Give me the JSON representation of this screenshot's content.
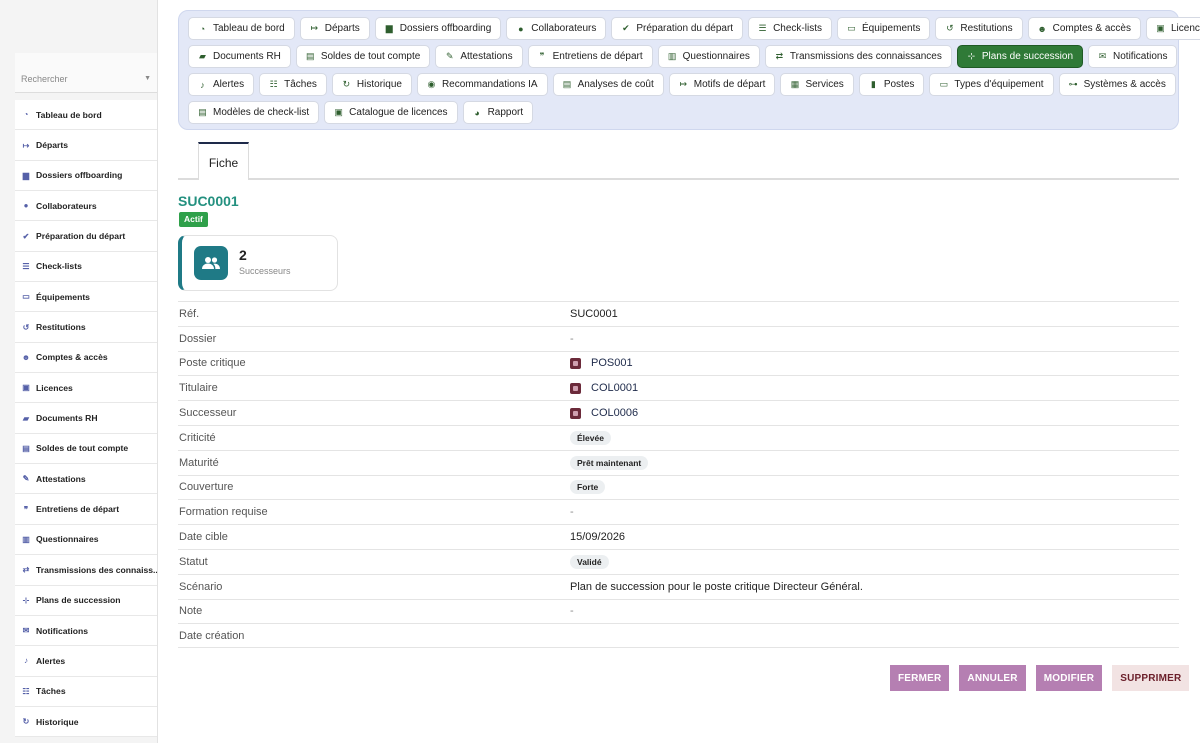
{
  "sidebar": {
    "search_placeholder": "Rechercher",
    "items": [
      {
        "label": "Tableau de bord",
        "icon": "dashboard-icon"
      },
      {
        "label": "Départs",
        "icon": "sign-out-icon"
      },
      {
        "label": "Dossiers offboarding",
        "icon": "folder-user-icon"
      },
      {
        "label": "Collaborateurs",
        "icon": "user-icon"
      },
      {
        "label": "Préparation du départ",
        "icon": "clipboard-check-icon"
      },
      {
        "label": "Check-lists",
        "icon": "list-icon"
      },
      {
        "label": "Équipements",
        "icon": "laptop-icon"
      },
      {
        "label": "Restitutions",
        "icon": "undo-icon"
      },
      {
        "label": "Comptes & accès",
        "icon": "users-key-icon"
      },
      {
        "label": "Licences",
        "icon": "license-icon"
      },
      {
        "label": "Documents RH",
        "icon": "folder-open-icon"
      },
      {
        "label": "Soldes de tout compte",
        "icon": "money-icon"
      },
      {
        "label": "Attestations",
        "icon": "certificate-icon"
      },
      {
        "label": "Entretiens de départ",
        "icon": "comments-icon"
      },
      {
        "label": "Questionnaires",
        "icon": "poll-icon"
      },
      {
        "label": "Transmissions des connaiss...",
        "icon": "exchange-icon"
      },
      {
        "label": "Plans de succession",
        "icon": "sitemap-icon"
      },
      {
        "label": "Notifications",
        "icon": "envelope-icon"
      },
      {
        "label": "Alertes",
        "icon": "bell-icon"
      },
      {
        "label": "Tâches",
        "icon": "tasks-icon"
      },
      {
        "label": "Historique",
        "icon": "history-icon"
      }
    ]
  },
  "nav": {
    "rows": [
      [
        {
          "label": "Tableau de bord",
          "icon": "dashboard-icon"
        },
        {
          "label": "Départs",
          "icon": "sign-out-icon"
        },
        {
          "label": "Dossiers offboarding",
          "icon": "folder-user-icon"
        },
        {
          "label": "Collaborateurs",
          "icon": "user-icon"
        },
        {
          "label": "Préparation du départ",
          "icon": "clipboard-check-icon"
        },
        {
          "label": "Check-lists",
          "icon": "list-icon"
        },
        {
          "label": "Équipements",
          "icon": "laptop-icon"
        },
        {
          "label": "Restitutions",
          "icon": "undo-icon"
        },
        {
          "label": "Comptes & accès",
          "icon": "users-key-icon"
        },
        {
          "label": "Licences",
          "icon": "license-icon"
        }
      ],
      [
        {
          "label": "Documents RH",
          "icon": "folder-open-icon"
        },
        {
          "label": "Soldes de tout compte",
          "icon": "money-icon"
        },
        {
          "label": "Attestations",
          "icon": "certificate-icon"
        },
        {
          "label": "Entretiens de départ",
          "icon": "comments-icon"
        },
        {
          "label": "Questionnaires",
          "icon": "poll-icon"
        },
        {
          "label": "Transmissions des connaissances",
          "icon": "exchange-icon"
        },
        {
          "label": "Plans de succession",
          "icon": "sitemap-icon",
          "active": true
        },
        {
          "label": "Notifications",
          "icon": "envelope-icon"
        }
      ],
      [
        {
          "label": "Alertes",
          "icon": "bell-icon"
        },
        {
          "label": "Tâches",
          "icon": "tasks-icon"
        },
        {
          "label": "Historique",
          "icon": "history-icon"
        },
        {
          "label": "Recommandations IA",
          "icon": "robot-icon"
        },
        {
          "label": "Analyses de coût",
          "icon": "cost-analysis-icon"
        },
        {
          "label": "Motifs de départ",
          "icon": "sign-out-icon"
        },
        {
          "label": "Services",
          "icon": "building-icon"
        },
        {
          "label": "Postes",
          "icon": "id-badge-icon"
        },
        {
          "label": "Types d'équipement",
          "icon": "laptop-icon"
        },
        {
          "label": "Systèmes & accès",
          "icon": "network-icon"
        }
      ],
      [
        {
          "label": "Modèles de check-list",
          "icon": "template-icon"
        },
        {
          "label": "Catalogue de licences",
          "icon": "catalog-icon"
        },
        {
          "label": "Rapport",
          "icon": "pie-chart-icon"
        }
      ]
    ]
  },
  "tabs": {
    "fiche": "Fiche"
  },
  "record": {
    "title": "SUC0001",
    "status": "Actif",
    "stat": {
      "value": "2",
      "label": "Successeurs",
      "icon": "users-icon"
    }
  },
  "fields": [
    {
      "label": "Réf.",
      "value": "SUC0001",
      "type": "text"
    },
    {
      "label": "Dossier",
      "value": "-",
      "type": "dash"
    },
    {
      "label": "Poste critique",
      "value": "POS001",
      "type": "ref"
    },
    {
      "label": "Titulaire",
      "value": "COL0001",
      "type": "ref"
    },
    {
      "label": "Successeur",
      "value": "COL0006",
      "type": "ref"
    },
    {
      "label": "Criticité",
      "value": "Élevée",
      "type": "chip"
    },
    {
      "label": "Maturité",
      "value": "Prêt maintenant",
      "type": "chip"
    },
    {
      "label": "Couverture",
      "value": "Forte",
      "type": "chip"
    },
    {
      "label": "Formation requise",
      "value": "-",
      "type": "dash"
    },
    {
      "label": "Date cible",
      "value": "15/09/2026",
      "type": "text"
    },
    {
      "label": "Statut",
      "value": "Validé",
      "type": "chip"
    },
    {
      "label": "Scénario",
      "value": "Plan de succession pour le poste critique Directeur Général.",
      "type": "text"
    },
    {
      "label": "Note",
      "value": "-",
      "type": "dash"
    },
    {
      "label": "Date création",
      "value": "",
      "type": "text"
    }
  ],
  "actions": {
    "close": "FERMER",
    "cancel": "ANNULER",
    "edit": "MODIFIER",
    "delete": "SUPPRIMER"
  },
  "colors": {
    "accent_green": "#2f7a37",
    "title_teal": "#23907f",
    "status_green": "#2fa04a",
    "button_purple": "#b57fb2",
    "delete_bg": "#f2e3e3"
  }
}
